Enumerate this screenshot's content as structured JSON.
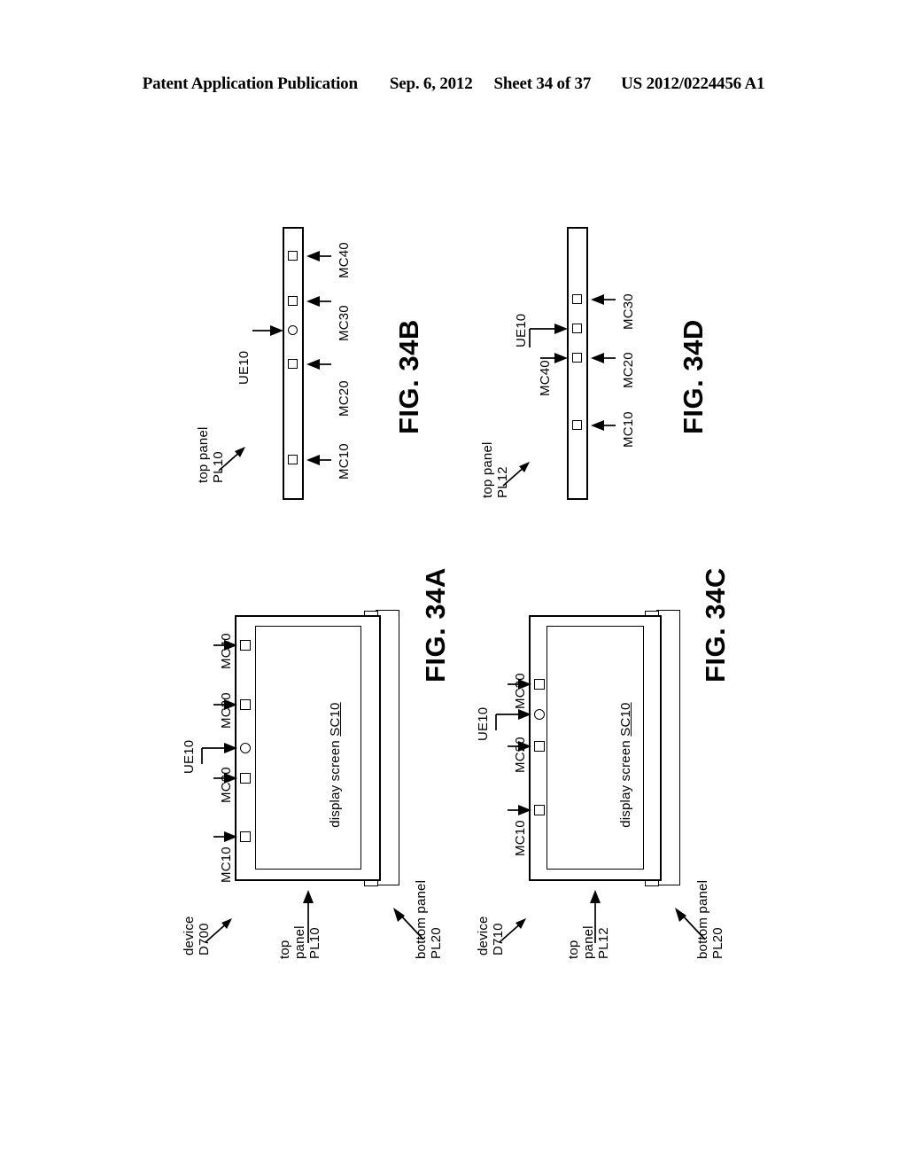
{
  "header": {
    "publication": "Patent Application Publication",
    "date": "Sep. 6, 2012",
    "sheet": "Sheet 34 of 37",
    "docnumber": "US 2012/0224456 A1"
  },
  "figures": [
    {
      "id": "fig34a",
      "name": "FIG. 34A",
      "labels": {
        "device": "device\nD700",
        "top_panel": "top\npanel\nPL10",
        "bottom_panel": "bottom panel\nPL20",
        "screen_prefix": "display screen ",
        "screen_ref": "SC10",
        "ue": "UE10",
        "mc10": "MC10",
        "mc20": "MC20",
        "mc30": "MC30",
        "mc40": "MC40"
      },
      "elements": [
        "square",
        "square",
        "circle",
        "square",
        "square"
      ]
    },
    {
      "id": "fig34b",
      "name": "FIG. 34B",
      "labels": {
        "top_panel": "top panel\nPL10",
        "ue": "UE10",
        "mc10": "MC10",
        "mc20": "MC20",
        "mc30": "MC30",
        "mc40": "MC40"
      },
      "elements": [
        "square",
        "square",
        "circle",
        "square",
        "square"
      ]
    },
    {
      "id": "fig34c",
      "name": "FIG. 34C",
      "labels": {
        "device": "device\nD710",
        "top_panel": "top\npanel\nPL12",
        "bottom_panel": "bottom panel\nPL20",
        "screen_prefix": "display screen ",
        "screen_ref": "SC10",
        "ue": "UE10",
        "mc10": "MC10",
        "mc20": "MC20",
        "mc30": "MC30"
      },
      "elements": [
        "square",
        "square",
        "circle",
        "square"
      ]
    },
    {
      "id": "fig34d",
      "name": "FIG. 34D",
      "labels": {
        "top_panel": "top panel\nPL12",
        "ue": "UE10",
        "mc10": "MC10",
        "mc20": "MC20",
        "mc30": "MC30",
        "mc40": "MC40"
      },
      "elements": [
        "square",
        "square",
        "square",
        "square"
      ]
    }
  ],
  "colors": {
    "ink": "#000000",
    "paper": "#ffffff"
  }
}
